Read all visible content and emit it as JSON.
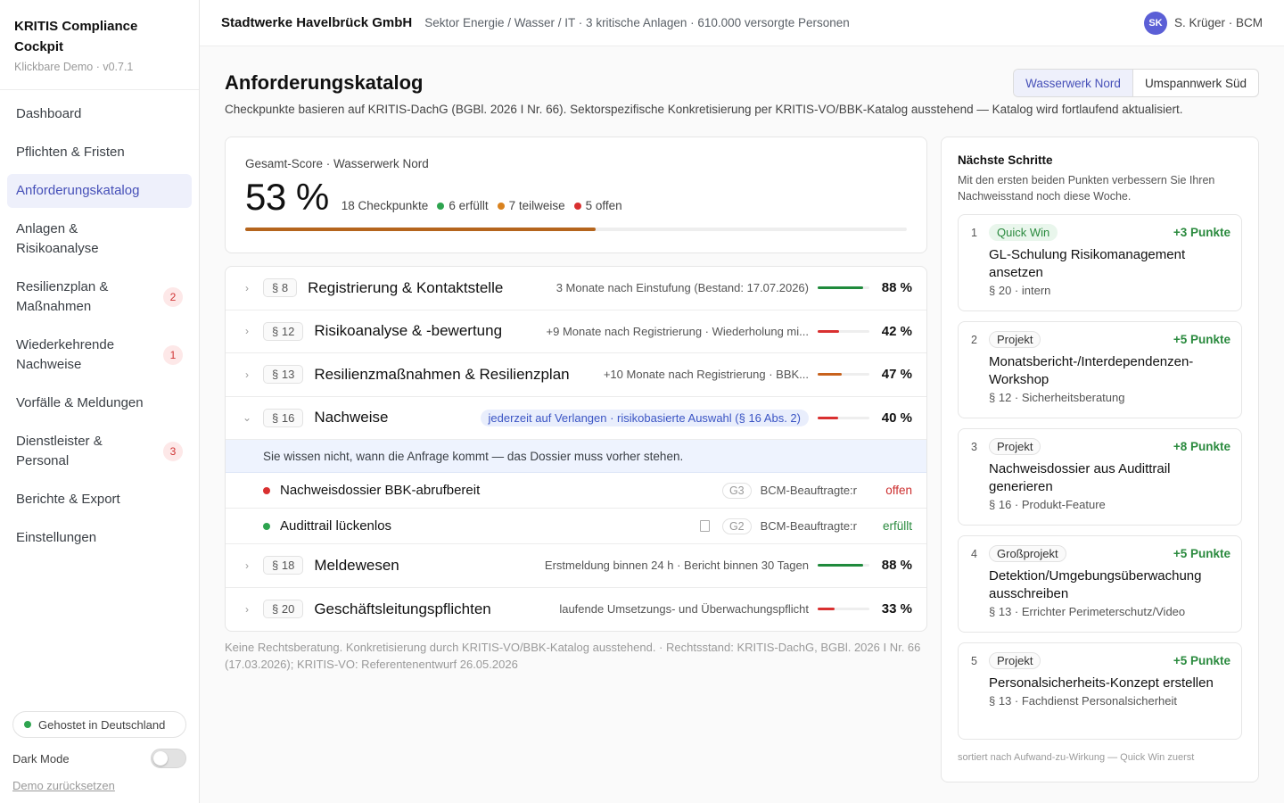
{
  "brand": {
    "title": "KRITIS Compliance Cockpit",
    "sub": "Klickbare Demo · v0.7.1"
  },
  "nav": [
    {
      "label": "Dashboard",
      "badge": ""
    },
    {
      "label": "Pflichten & Fristen",
      "badge": ""
    },
    {
      "label": "Anforderungskatalog",
      "badge": "",
      "active": true
    },
    {
      "label": "Anlagen & Risikoanalyse",
      "badge": ""
    },
    {
      "label": "Resilienzplan & Maßnahmen",
      "badge": "2"
    },
    {
      "label": "Wiederkehrende Nachweise",
      "badge": "1"
    },
    {
      "label": "Vorfälle & Meldungen",
      "badge": ""
    },
    {
      "label": "Dienstleister & Personal",
      "badge": "3"
    },
    {
      "label": "Berichte & Export",
      "badge": ""
    },
    {
      "label": "Einstellungen",
      "badge": ""
    }
  ],
  "footer": {
    "hosted": "Gehostet in Deutschland",
    "dark_mode": "Dark Mode",
    "reset": "Demo zurücksetzen"
  },
  "header": {
    "org": "Stadtwerke Havelbrück GmbH",
    "meta": "Sektor Energie / Wasser / IT · 3 kritische Anlagen · 610.000 versorgte Personen",
    "user_initials": "SK",
    "user": "S. Krüger · BCM"
  },
  "page": {
    "title": "Anforderungskatalog",
    "desc": "Checkpunkte basieren auf KRITIS-DachG (BGBl. 2026 I Nr. 66). Sektorspezifische Konkretisierung per KRITIS-VO/BBK-Katalog ausstehend — Katalog wird fortlaufend aktualisiert.",
    "sites": [
      "Wasserwerk Nord",
      "Umspannwerk Süd"
    ]
  },
  "score": {
    "label": "Gesamt-Score · Wasserwerk Nord",
    "value": "53 %",
    "fraction": 0.53,
    "checkpoints": "18 Checkpunkte",
    "done": "6 erfüllt",
    "partial": "7 teilweise",
    "open": "5 offen"
  },
  "sections": [
    {
      "para": "§ 8",
      "title": "Registrierung & Kontaktstelle",
      "meta": "3 Monate nach Einstufung (Bestand: 17.07.2026)",
      "pct": "88 %",
      "value": 0.88,
      "color": "#1f8a3c"
    },
    {
      "para": "§ 12",
      "title": "Risikoanalyse & -bewertung",
      "meta": "+9 Monate nach Registrierung · Wiederholung mi...",
      "pct": "42 %",
      "value": 0.42,
      "color": "#d93030"
    },
    {
      "para": "§ 13",
      "title": "Resilienzmaßnahmen & Resilienzplan",
      "meta": "+10 Monate nach Registrierung · BBK...",
      "pct": "47 %",
      "value": 0.47,
      "color": "#c8621d"
    },
    {
      "para": "§ 16",
      "title": "Nachweise",
      "meta": "jederzeit auf Verlangen · risikobasierte Auswahl (§ 16 Abs. 2)",
      "pct": "40 %",
      "value": 0.4,
      "color": "#d93030"
    }
  ],
  "expanded": {
    "note": "Sie wissen nicht, wann die Anfrage kommt — das Dossier muss vorher stehen.",
    "items": [
      {
        "title": "Nachweisdossier BBK-abrufbereit",
        "grade": "G3",
        "owner": "BCM-Beauftragte:r",
        "status": "offen"
      },
      {
        "title": "Audittrail lückenlos",
        "grade": "G2",
        "owner": "BCM-Beauftragte:r",
        "status": "erfüllt"
      }
    ]
  },
  "sections_after": [
    {
      "para": "§ 18",
      "title": "Meldewesen",
      "meta": "Erstmeldung binnen 24 h · Bericht binnen 30 Tagen",
      "pct": "88 %",
      "value": 0.88,
      "color": "#1f8a3c"
    },
    {
      "para": "§ 20",
      "title": "Geschäftsleitungspflichten",
      "meta": "laufende Umsetzungs- und Überwachungspflicht",
      "pct": "33 %",
      "value": 0.33,
      "color": "#d93030"
    }
  ],
  "footnote": "Keine Rechtsberatung. Konkretisierung durch KRITIS-VO/BBK-Katalog ausstehend. · Rechtsstand: KRITIS-DachG, BGBl. 2026 I Nr. 66 (17.03.2026); KRITIS-VO: Referentenentwurf 26.05.2026",
  "next": {
    "title": "Nächste Schritte",
    "desc": "Mit den ersten beiden Punkten verbessern Sie Ihren Nachweisstand noch diese Woche.",
    "steps": [
      {
        "num": "1",
        "tag": "Quick Win",
        "points": "+3 Punkte",
        "title": "GL-Schulung Risikomanagement ansetzen",
        "sub": "§ 20 · intern"
      },
      {
        "num": "2",
        "tag": "Projekt",
        "points": "+5 Punkte",
        "title": "Monatsbericht-/Interdependenzen-Workshop",
        "sub": "§ 12 · Sicherheitsberatung"
      },
      {
        "num": "3",
        "tag": "Projekt",
        "points": "+8 Punkte",
        "title": "Nachweisdossier aus Audittrail generieren",
        "sub": "§ 16 · Produkt-Feature"
      },
      {
        "num": "4",
        "tag": "Großprojekt",
        "points": "+5 Punkte",
        "title": "Detektion/Umgebungsüberwachung ausschreiben",
        "sub": "§ 13 · Errichter Perimeterschutz/Video"
      },
      {
        "num": "5",
        "tag": "Projekt",
        "points": "+5 Punkte",
        "title": "Personalsicherheits-Konzept erstellen",
        "sub": "§ 13 · Fachdienst Personalsicherheit"
      }
    ],
    "foot": "sortiert nach Aufwand-zu-Wirkung — Quick Win zuerst"
  }
}
